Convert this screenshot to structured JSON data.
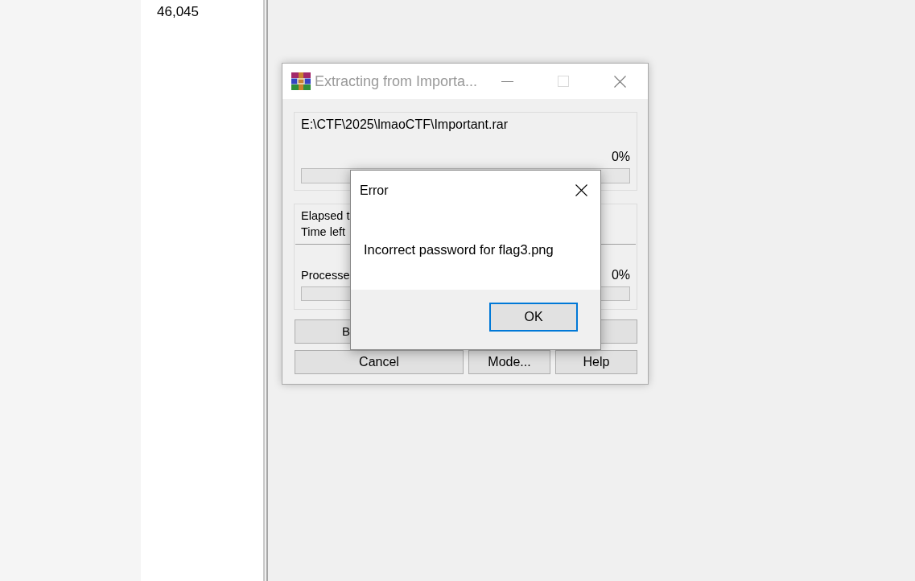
{
  "file_list": {
    "cells": [
      "46,045"
    ]
  },
  "extract_window": {
    "title": "Extracting from Importa...",
    "active": false,
    "window_buttons": [
      {
        "kind": "minimize",
        "disabled": false
      },
      {
        "kind": "maximize",
        "disabled": true
      },
      {
        "kind": "close",
        "disabled": false
      }
    ],
    "archive": {
      "path": "E:\\CTF\\2025\\lmaoCTF\\Important.rar",
      "reading": "0%",
      "level": 0
    },
    "times": {
      "lines": [
        "Elapsed t",
        "Time left"
      ]
    },
    "processed": {
      "label": "Processe",
      "reading": "0%",
      "level": 0
    },
    "button_rows": [
      [
        {
          "label": "B"
        },
        {}
      ],
      [
        {
          "label": "Cancel"
        },
        {
          "label": "Mode..."
        },
        {
          "label": "Help"
        }
      ]
    ]
  },
  "error_dialog": {
    "title": "Error",
    "message": "Incorrect password for flag3.png",
    "buttons": [
      {
        "label": "OK",
        "default": true
      }
    ]
  }
}
